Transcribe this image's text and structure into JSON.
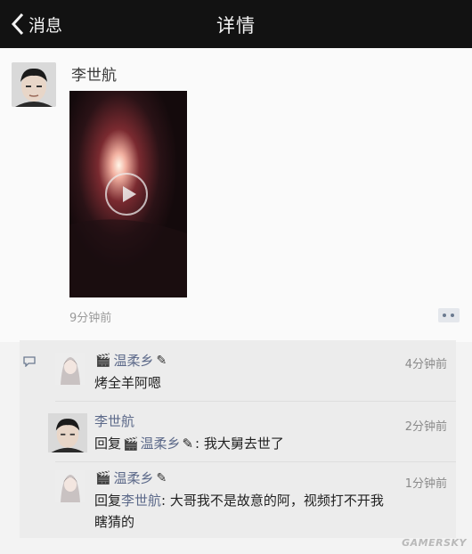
{
  "header": {
    "back_label": "消息",
    "title": "详情"
  },
  "post": {
    "author": "李世航",
    "media_type": "video",
    "time": "9分钟前"
  },
  "comments": [
    {
      "author": "温柔乡",
      "time": "4分钟前",
      "text": "烤全羊阿嗯"
    },
    {
      "author": "李世航",
      "time": "2分钟前",
      "reply_prefix": "回复",
      "reply_to": "温柔乡",
      "text": ": 我大舅去世了"
    },
    {
      "author": "温柔乡",
      "time": "1分钟前",
      "reply_prefix": "回复",
      "reply_to": "李世航",
      "text": ": 大哥我不是故意的阿，视频打不开我",
      "text_line2": "瞎猜的"
    }
  ],
  "watermark": "GAMERSKY",
  "colors": {
    "header_bg": "#121212",
    "link_blue": "#5d6a8a",
    "comment_bg": "#ececec"
  }
}
